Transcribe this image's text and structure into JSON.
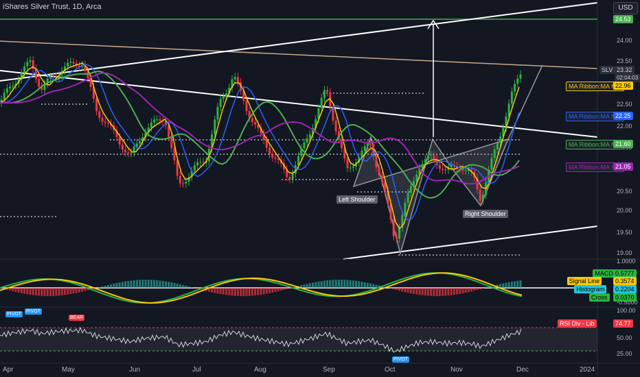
{
  "title": "iShares Silver Trust, 1D, Arca",
  "currency": "USD",
  "symbol": "SLV",
  "price": "23.32",
  "countdown": "02:04:03",
  "top_level_price": "24.53",
  "ma_labels": [
    {
      "name": "MA Ribbon:MA №1",
      "value": "22.96",
      "color": "#f9c80e"
    },
    {
      "name": "MA Ribbon:MA №2",
      "value": "22.25",
      "color": "#2962ff"
    },
    {
      "name": "MA Ribbon:MA №3",
      "value": "21.60",
      "color": "#4caf50"
    },
    {
      "name": "MA Ribbon:MA №4",
      "value": "21.05",
      "color": "#9c27b0"
    }
  ],
  "price_axis": [
    "24.00",
    "23.50",
    "22.50",
    "22.00",
    "21.50",
    "20.50",
    "20.00",
    "19.50",
    "19.00"
  ],
  "macd_axis": [
    "1.0000",
    "-0.5000"
  ],
  "macd_labels": [
    {
      "name": "MACD",
      "value": "0.5777",
      "color": "#2bb541"
    },
    {
      "name": "Signal Line",
      "value": "0.3574",
      "color": "#f9c80e"
    },
    {
      "name": "Histogram",
      "value": "0.2204",
      "color": "#26c6da"
    },
    {
      "name": "Cross",
      "value": "0.0370",
      "color": "#2bb541"
    }
  ],
  "rsi_axis": [
    "100.00",
    "50.00",
    "25.00"
  ],
  "rsi_label": {
    "name": "RSI Div - Lib",
    "value": "74.77"
  },
  "x_axis": [
    "Apr",
    "May",
    "Jun",
    "Jul",
    "Aug",
    "Sep",
    "Oct",
    "Nov",
    "Dec",
    "2024"
  ],
  "annotations": {
    "left_shoulder": "Left Shoulder",
    "right_shoulder": "Right Shoulder"
  },
  "rsi_markers": {
    "pivot": "PIVOT",
    "bear": "BEAR"
  },
  "colors": {
    "background": "#131722",
    "up": "#2bb541",
    "down": "#f23645",
    "ma1": "#f9c80e",
    "ma2": "#2962ff",
    "ma3": "#4caf50",
    "ma4": "#9c27b0"
  }
}
